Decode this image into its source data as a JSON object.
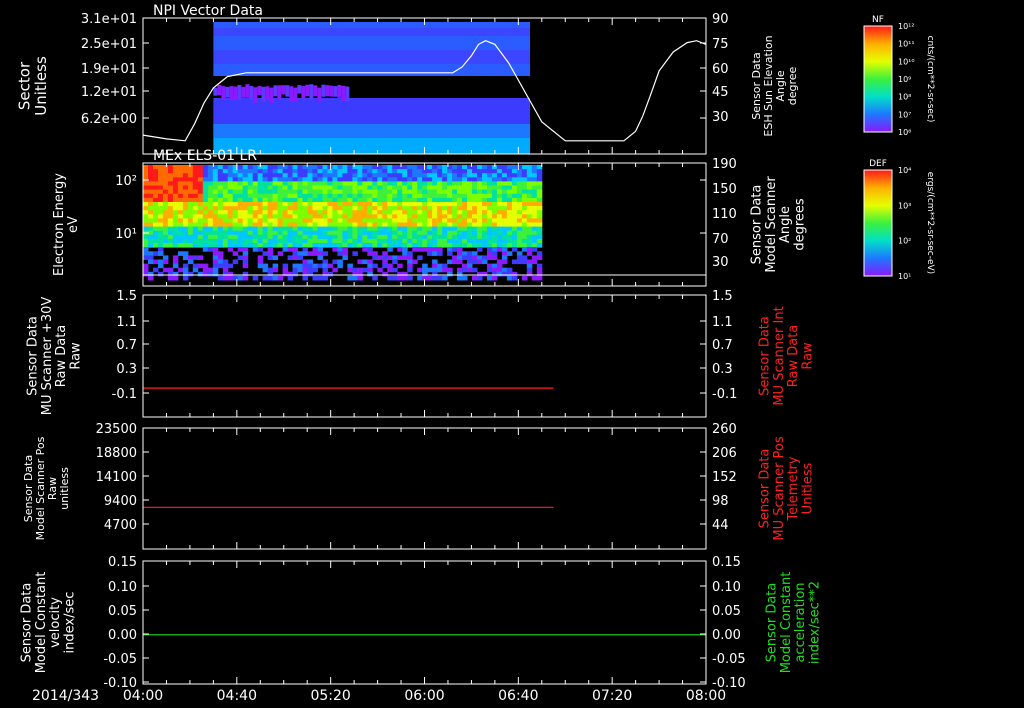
{
  "footer": {
    "date_label": "2014/343"
  },
  "colorbars": [
    {
      "title": "NF",
      "units": "cnts/(cm**2-sr-sec)",
      "ticks": [
        "10¹²",
        "10¹¹",
        "10¹⁰",
        "10⁹",
        "10⁸",
        "10⁷",
        "10⁶"
      ],
      "colors": [
        "#ff1a1a",
        "#ffae00",
        "#e6ff00",
        "#3cf03c",
        "#00e0c8",
        "#1e78ff",
        "#8a1aff"
      ]
    },
    {
      "title": "DEF",
      "units": "ergs/(cm**2-sr-sec-eV)",
      "ticks": [
        "10⁴",
        "10³",
        "10²",
        "10¹"
      ],
      "colors": [
        "#ff1a1a",
        "#ffae00",
        "#e6ff00",
        "#3cf03c",
        "#00e0c8",
        "#1e78ff",
        "#8a1aff"
      ]
    }
  ],
  "chart_data": [
    {
      "type": "heatmap",
      "title": "NPI Vector Data",
      "ylabel": "Sector\nUnitless",
      "y_ticks": [
        "3.1e+01",
        "2.5e+01",
        "1.9e+01",
        "1.2e+01",
        "6.2e+00"
      ],
      "y2label": "Sensor Data\nESH Sun Elevation\nAngle\ndegree",
      "y2_ticks": [
        90,
        75,
        60,
        45,
        30
      ],
      "y2lim": [
        18,
        90
      ],
      "xlim": [
        0,
        240
      ],
      "data_extent_min": [
        30,
        165
      ],
      "overlay_line": {
        "color": "#ffffff",
        "x": [
          0,
          10,
          18,
          22,
          26,
          30,
          36,
          40,
          44,
          48,
          60,
          120,
          132,
          136,
          140,
          143,
          146,
          150,
          156,
          170,
          180,
          200,
          205,
          210,
          213,
          216,
          220,
          226,
          232,
          236,
          240
        ],
        "y": [
          28,
          26,
          25,
          34,
          45,
          53,
          59,
          60,
          61,
          61,
          61,
          61,
          61,
          64,
          70,
          76,
          78,
          76,
          66,
          35,
          25,
          25,
          25,
          30,
          38,
          48,
          62,
          72,
          77,
          78,
          76
        ]
      }
    },
    {
      "type": "heatmap",
      "title": "MEx ELS-01 LR",
      "ylabel": "Electron Energy\neV",
      "y_ticks": [
        "10²",
        "10¹"
      ],
      "y2label": "Sensor Data\nModel Scanner\nAngle\ndegrees",
      "y2_ticks": [
        190,
        150,
        110,
        70,
        30
      ],
      "xlim": [
        0,
        240
      ],
      "data_extent_min": [
        0,
        170
      ],
      "overlay_line": {
        "color": "#ffffff",
        "value": 12
      }
    },
    {
      "type": "line",
      "ylabel": "Sensor Data\nMU Scanner +30V\nRaw Data\nRaw",
      "y_ticks": [
        "1.5",
        "1.1",
        "0.7",
        "0.3",
        "-0.1"
      ],
      "ylim": [
        -0.4,
        1.5
      ],
      "y2label": "Sensor Data\nMU Scanner Int\nRaw Data\nRaw",
      "y2_ticks": [
        "1.5",
        "1.1",
        "0.7",
        "0.3",
        "-0.1"
      ],
      "series": [
        {
          "color": "#ff2020",
          "x": [
            0,
            175
          ],
          "y": [
            0.05,
            0.05
          ]
        }
      ]
    },
    {
      "type": "line",
      "ylabel": "Sensor Data\nModel Scanner Pos\nRaw\nunitless",
      "y_ticks": [
        "23500",
        "18800",
        "14100",
        "9400",
        "4700"
      ],
      "ylim": [
        0,
        23500
      ],
      "y2label": "Sensor Data\nMU Scanner Pos\nTelemetry\nUnitless",
      "y2_ticks": [
        "260",
        "206",
        "152",
        "98",
        "44"
      ],
      "series": [
        {
          "color": "#ff2020",
          "x": [
            0,
            175
          ],
          "y": [
            8100,
            8100
          ]
        }
      ]
    },
    {
      "type": "line",
      "ylabel": "Sensor Data\nModel Constant\nvelocity\nindex/sec",
      "y_ticks": [
        "0.15",
        "0.10",
        "0.05",
        "0.00",
        "-0.05",
        "-0.10"
      ],
      "ylim": [
        -0.1,
        0.15
      ],
      "y2label": "Sensor Data\nModel Constant\nacceleration\nindex/sec**2",
      "y2_ticks": [
        "0.15",
        "0.10",
        "0.05",
        "0.00",
        "-0.05",
        "-0.10"
      ],
      "series": [
        {
          "color": "#22dd22",
          "x": [
            0,
            240
          ],
          "y": [
            0,
            0
          ]
        }
      ]
    }
  ],
  "x_ticks": [
    "04:00",
    "04:40",
    "05:20",
    "06:00",
    "06:40",
    "07:20",
    "08:00"
  ],
  "x_minutes": [
    0,
    40,
    80,
    120,
    160,
    200,
    240
  ]
}
